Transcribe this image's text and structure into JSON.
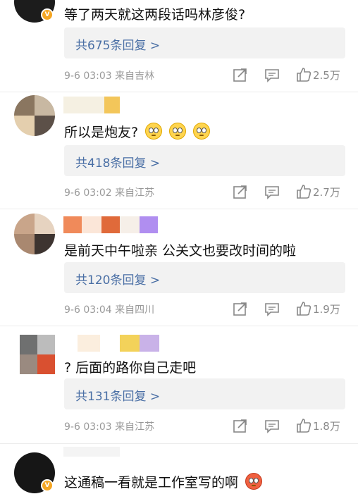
{
  "comments": [
    {
      "text": "等了两天就这两段话吗林彦俊?",
      "replies": "共675条回复 >",
      "meta": "9-6 03:03  来自吉林",
      "likes": "2.5万"
    },
    {
      "text": "所以是炮友?",
      "replies": "共418条回复 >",
      "meta": "9-6 03:02  来自江苏",
      "likes": "2.7万"
    },
    {
      "text": "是前天中午啦亲 公关文也要改时间的啦",
      "replies": "共120条回复 >",
      "meta": "9-6 03:04  来自四川",
      "likes": "1.9万"
    },
    {
      "text": "? 后面的路你自己走吧",
      "replies": "共131条回复 >",
      "meta": "9-6 03:03  来自江苏",
      "likes": "1.8万"
    },
    {
      "text": "这通稿一看就是工作室写的啊"
    }
  ],
  "icons": {
    "share": "share-icon",
    "comment": "comment-icon",
    "like": "thumbs-up-icon",
    "emoji_thinking": "thinking-face-emoji",
    "emoji_angry": "angry-face-emoji"
  },
  "colors": {
    "link": "#4a6fa5",
    "meta": "#999999",
    "reply_bg": "#f2f2f2",
    "badge": "#f5a623"
  }
}
